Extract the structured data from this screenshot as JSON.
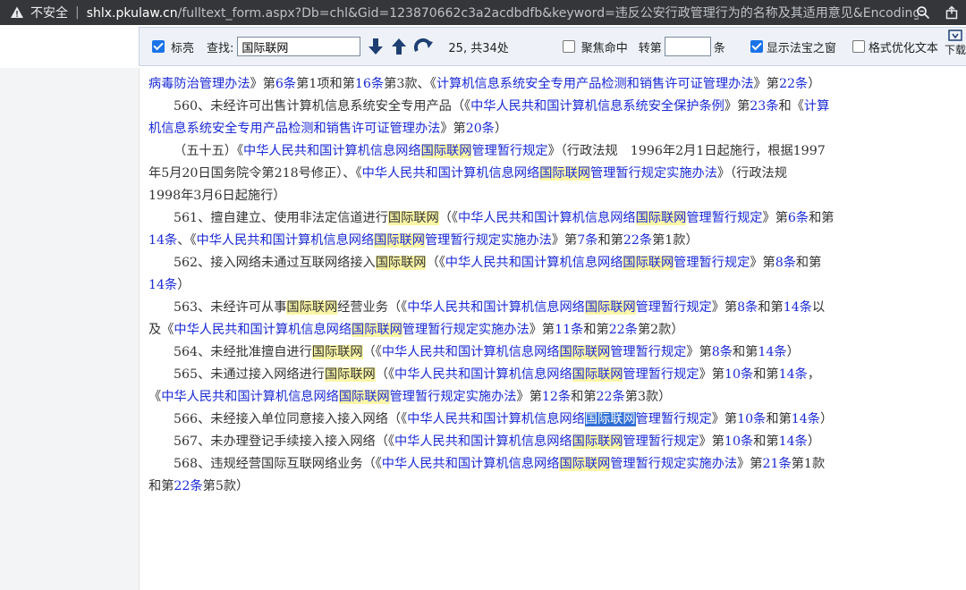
{
  "browser": {
    "insecure_label": "不安全",
    "separator": "|",
    "url_host": "shlx.pkulaw.cn",
    "url_rest": "/fulltext_form.aspx?Db=chl&Gid=123870662c3a2acdbdfb&keyword=违反公安行政管理行为的名称及其适用意见&EncodingNa..."
  },
  "toolbar": {
    "highlight_label": "标亮",
    "highlight_checked": true,
    "find_label": "查找:",
    "search_value": "国际联网",
    "match_status": "25, 共34处",
    "focus_label": "聚焦命中",
    "focus_checked": false,
    "goto_label": "转第",
    "goto_suffix": "条",
    "show_window_label": "显示法宝之窗",
    "show_window_checked": true,
    "format_label": "格式优化文本",
    "format_checked": false,
    "download_label": "下载"
  },
  "colors": {
    "link": "#1a2ad6",
    "highlight": "#fbf6a8",
    "current_highlight": "#2f6fd6"
  },
  "paragraphs": [
    {
      "indent": false,
      "segments": [
        {
          "t": "病毒防治管理办法",
          "c": "law"
        },
        {
          "t": "》第",
          "c": ""
        },
        {
          "t": "6条",
          "c": "art"
        },
        {
          "t": "第1项和第",
          "c": ""
        },
        {
          "t": "16条",
          "c": "art"
        },
        {
          "t": "第3款、《",
          "c": ""
        },
        {
          "t": "计算机信息系统安全专用产品检测和销售许可证管理办法",
          "c": "law"
        },
        {
          "t": "》第",
          "c": ""
        },
        {
          "t": "22条",
          "c": "art"
        },
        {
          "t": "）",
          "c": ""
        }
      ]
    },
    {
      "indent": true,
      "segments": [
        {
          "t": "560、未经许可出售计算机信息系统安全专用产品（《",
          "c": ""
        },
        {
          "t": "中华人民共和国计算机信息系统安全保护条例",
          "c": "law"
        },
        {
          "t": "》第",
          "c": ""
        },
        {
          "t": "23条",
          "c": "art"
        },
        {
          "t": "和《",
          "c": ""
        },
        {
          "t": "计算机信息系统安全专用产品检测和销售许可证管理办法",
          "c": "law"
        },
        {
          "t": "》第",
          "c": ""
        },
        {
          "t": "20条",
          "c": "art"
        },
        {
          "t": "）",
          "c": ""
        }
      ]
    },
    {
      "indent": true,
      "segments": [
        {
          "t": "（五十五）《",
          "c": ""
        },
        {
          "t": "中华人民共和国计算机信息网络",
          "c": "law"
        },
        {
          "t": "国际联网",
          "c": "law hl"
        },
        {
          "t": "管理暂行规定",
          "c": "law"
        },
        {
          "t": "》（行政法规　1996年2月1日起施行，根据1997年5月20日国务院令第218号修正）、《",
          "c": ""
        },
        {
          "t": "中华人民共和国计算机信息网络",
          "c": "law"
        },
        {
          "t": "国际联网",
          "c": "law hl"
        },
        {
          "t": "管理暂行规定实施办法",
          "c": "law"
        },
        {
          "t": "》（行政法规　　1998年3月6日起施行）",
          "c": ""
        }
      ]
    },
    {
      "indent": true,
      "segments": [
        {
          "t": "561、擅自建立、使用非法定信道进行",
          "c": ""
        },
        {
          "t": "国际联网",
          "c": "hl"
        },
        {
          "t": "（《",
          "c": ""
        },
        {
          "t": "中华人民共和国计算机信息网络",
          "c": "law"
        },
        {
          "t": "国际联网",
          "c": "law hl"
        },
        {
          "t": "管理暂行规定",
          "c": "law"
        },
        {
          "t": "》第",
          "c": ""
        },
        {
          "t": "6条",
          "c": "art"
        },
        {
          "t": "和第",
          "c": ""
        },
        {
          "t": "14条",
          "c": "art"
        },
        {
          "t": "、《",
          "c": ""
        },
        {
          "t": "中华人民共和国计算机信息网络",
          "c": "law"
        },
        {
          "t": "国际联网",
          "c": "law hl"
        },
        {
          "t": "管理暂行规定实施办法",
          "c": "law"
        },
        {
          "t": "》第",
          "c": ""
        },
        {
          "t": "7条",
          "c": "art"
        },
        {
          "t": "和第",
          "c": ""
        },
        {
          "t": "22条",
          "c": "art"
        },
        {
          "t": "第1款）",
          "c": ""
        }
      ]
    },
    {
      "indent": true,
      "segments": [
        {
          "t": "562、接入网络未通过互联网络接入",
          "c": ""
        },
        {
          "t": "国际联网",
          "c": "hl"
        },
        {
          "t": "（《",
          "c": ""
        },
        {
          "t": "中华人民共和国计算机信息网络",
          "c": "law"
        },
        {
          "t": "国际联网",
          "c": "law hl"
        },
        {
          "t": "管理暂行规定",
          "c": "law"
        },
        {
          "t": "》第",
          "c": ""
        },
        {
          "t": "8条",
          "c": "art"
        },
        {
          "t": "和第",
          "c": ""
        },
        {
          "t": "14条",
          "c": "art"
        },
        {
          "t": "）",
          "c": ""
        }
      ]
    },
    {
      "indent": true,
      "segments": [
        {
          "t": "563、未经许可从事",
          "c": ""
        },
        {
          "t": "国际联网",
          "c": "hl"
        },
        {
          "t": "经营业务（《",
          "c": ""
        },
        {
          "t": "中华人民共和国计算机信息网络",
          "c": "law"
        },
        {
          "t": "国际联网",
          "c": "law hl"
        },
        {
          "t": "管理暂行规定",
          "c": "law"
        },
        {
          "t": "》第",
          "c": ""
        },
        {
          "t": "8条",
          "c": "art"
        },
        {
          "t": "和第",
          "c": ""
        },
        {
          "t": "14条",
          "c": "art"
        },
        {
          "t": "以及《",
          "c": ""
        },
        {
          "t": "中华人民共和国计算机信息网络",
          "c": "law"
        },
        {
          "t": "国际联网",
          "c": "law hl"
        },
        {
          "t": "管理暂行规定实施办法",
          "c": "law"
        },
        {
          "t": "》第",
          "c": ""
        },
        {
          "t": "11条",
          "c": "art"
        },
        {
          "t": "和第",
          "c": ""
        },
        {
          "t": "22条",
          "c": "art"
        },
        {
          "t": "第2款）",
          "c": ""
        }
      ]
    },
    {
      "indent": true,
      "segments": [
        {
          "t": "564、未经批准擅自进行",
          "c": ""
        },
        {
          "t": "国际联网",
          "c": "hl"
        },
        {
          "t": "（《",
          "c": ""
        },
        {
          "t": "中华人民共和国计算机信息网络",
          "c": "law"
        },
        {
          "t": "国际联网",
          "c": "law hl"
        },
        {
          "t": "管理暂行规定",
          "c": "law"
        },
        {
          "t": "》第",
          "c": ""
        },
        {
          "t": "8条",
          "c": "art"
        },
        {
          "t": "和第",
          "c": ""
        },
        {
          "t": "14条",
          "c": "art"
        },
        {
          "t": "）",
          "c": ""
        }
      ]
    },
    {
      "indent": true,
      "segments": [
        {
          "t": "565、未通过接入网络进行",
          "c": ""
        },
        {
          "t": "国际联网",
          "c": "hl"
        },
        {
          "t": "（《",
          "c": ""
        },
        {
          "t": "中华人民共和国计算机信息网络",
          "c": "law"
        },
        {
          "t": "国际联网",
          "c": "law hl"
        },
        {
          "t": "管理暂行规定",
          "c": "law"
        },
        {
          "t": "》第",
          "c": ""
        },
        {
          "t": "10条",
          "c": "art"
        },
        {
          "t": "和第",
          "c": ""
        },
        {
          "t": "14条",
          "c": "art"
        },
        {
          "t": "，《",
          "c": ""
        },
        {
          "t": "中华人民共和国计算机信息网络",
          "c": "law"
        },
        {
          "t": "国际联网",
          "c": "law hl"
        },
        {
          "t": "管理暂行规定实施办法",
          "c": "law"
        },
        {
          "t": "》第",
          "c": ""
        },
        {
          "t": "12条",
          "c": "art"
        },
        {
          "t": "和第",
          "c": ""
        },
        {
          "t": "22条",
          "c": "art"
        },
        {
          "t": "第3款）",
          "c": ""
        }
      ]
    },
    {
      "indent": true,
      "segments": [
        {
          "t": "566、未经接入单位同意接入接入网络（《",
          "c": ""
        },
        {
          "t": "中华人民共和国计算机信息网络",
          "c": "law"
        },
        {
          "t": "国际联网",
          "c": "law hl-cur"
        },
        {
          "t": "管理暂行规定",
          "c": "law"
        },
        {
          "t": "》第",
          "c": ""
        },
        {
          "t": "10条",
          "c": "art"
        },
        {
          "t": "和第",
          "c": ""
        },
        {
          "t": "14条",
          "c": "art"
        },
        {
          "t": "）",
          "c": ""
        }
      ]
    },
    {
      "indent": true,
      "segments": [
        {
          "t": "567、未办理登记手续接入接入网络（《",
          "c": ""
        },
        {
          "t": "中华人民共和国计算机信息网络",
          "c": "law"
        },
        {
          "t": "国际联网",
          "c": "law hl"
        },
        {
          "t": "管理暂行规定",
          "c": "law"
        },
        {
          "t": "》第",
          "c": ""
        },
        {
          "t": "10条",
          "c": "art"
        },
        {
          "t": "和第",
          "c": ""
        },
        {
          "t": "14条",
          "c": "art"
        },
        {
          "t": "）",
          "c": ""
        }
      ]
    },
    {
      "indent": true,
      "segments": [
        {
          "t": "568、违规经营国际互联网络业务（《",
          "c": ""
        },
        {
          "t": "中华人民共和国计算机信息网络",
          "c": "law"
        },
        {
          "t": "国际联网",
          "c": "law hl"
        },
        {
          "t": "管理暂行规定实施办法",
          "c": "law"
        },
        {
          "t": "》第",
          "c": ""
        },
        {
          "t": "21条",
          "c": "art"
        },
        {
          "t": "第1款和第",
          "c": ""
        },
        {
          "t": "22条",
          "c": "art"
        },
        {
          "t": "第5款）",
          "c": ""
        }
      ]
    }
  ]
}
